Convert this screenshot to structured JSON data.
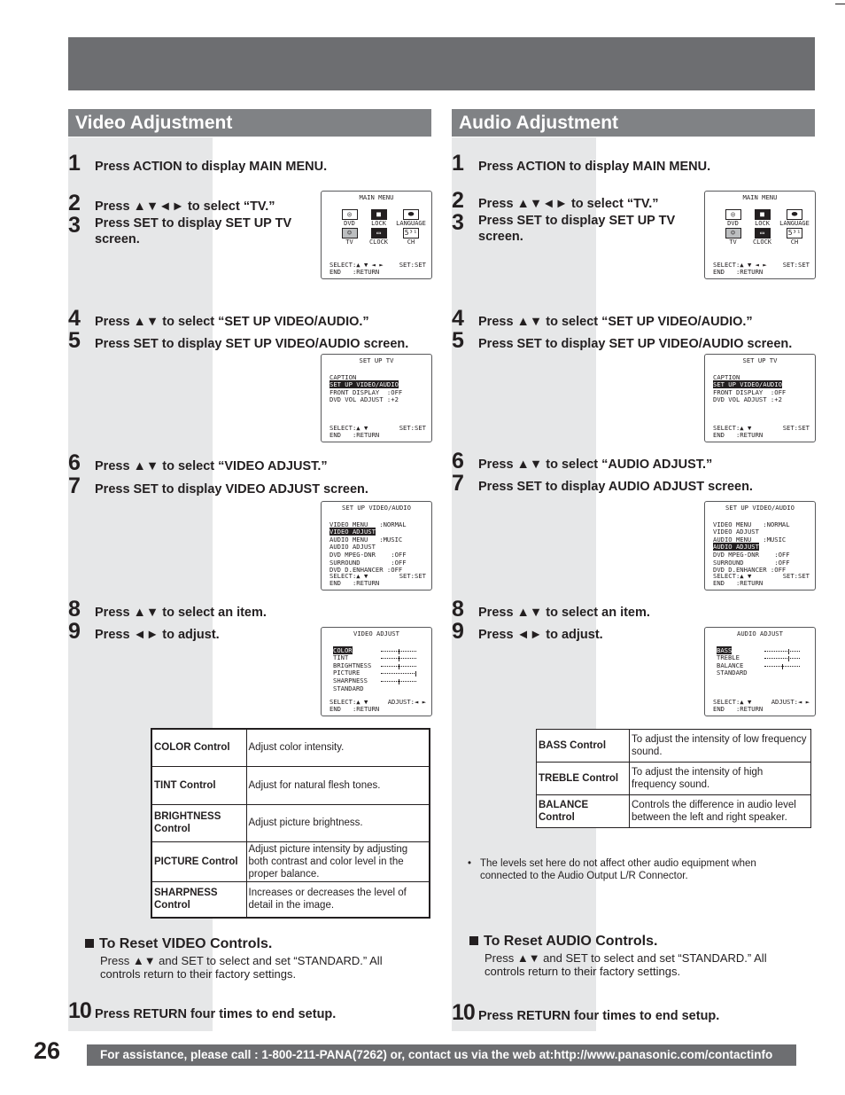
{
  "page": {
    "number": "26"
  },
  "footer": {
    "assistance": "For assistance, please call : 1-800-211-PANA(7262) or, contact us via the web at:http://www.panasonic.com/contactinfo"
  },
  "colors": {
    "banner": "#6d6e71",
    "section_title": "#808285",
    "shade": "#e6e7e8",
    "text": "#231f20"
  },
  "osd_common": {
    "main_menu": {
      "title": "MAIN MENU",
      "icons": [
        {
          "label": "DVD",
          "icon": "disc-icon"
        },
        {
          "label": "LOCK",
          "icon": "lock-icon"
        },
        {
          "label": "LANGUAGE",
          "icon": "lips-icon"
        },
        {
          "label": "TV",
          "icon": "tv-icon"
        },
        {
          "label": "CLOCK",
          "icon": "clock-icon"
        },
        {
          "label": "CH",
          "icon": "channel-icon"
        }
      ],
      "footer_left": "SELECT:▲ ▼ ◄ ►",
      "footer_right": "SET:SET",
      "footer_end": "END   :RETURN"
    },
    "setup_tv": {
      "title": "SET UP TV",
      "rows": [
        "CAPTION",
        "SET UP VIDEO/AUDIO",
        "FRONT DISPLAY  :OFF",
        "DVD VOL ADJUST :+2"
      ],
      "highlight": 1,
      "footer_left": "SELECT:▲ ▼",
      "footer_right": "SET:SET",
      "footer_end": "END   :RETURN"
    }
  },
  "video": {
    "title": "Video Adjustment",
    "steps": [
      {
        "n": "1",
        "text": "Press ACTION to display MAIN MENU."
      },
      {
        "n": "2",
        "text": "Press ▲▼◄► to select “TV.”"
      },
      {
        "n": "3",
        "text": "Press SET to display SET UP TV screen."
      },
      {
        "n": "4",
        "text": "Press ▲▼ to select “SET UP VIDEO/AUDIO.”"
      },
      {
        "n": "5",
        "text": "Press SET to display SET UP VIDEO/AUDIO screen."
      },
      {
        "n": "6",
        "text": "Press ▲▼ to select “VIDEO ADJUST.”"
      },
      {
        "n": "7",
        "text": "Press SET to display VIDEO ADJUST screen."
      },
      {
        "n": "8",
        "text": "Press ▲▼ to select an item."
      },
      {
        "n": "9",
        "text": "Press ◄► to adjust."
      },
      {
        "n": "10",
        "text": "Press RETURN four times to end setup."
      }
    ],
    "setup_va": {
      "title": "SET UP VIDEO/AUDIO",
      "rows": [
        "VIDEO MENU   :NORMAL",
        "VIDEO ADJUST",
        "AUDIO MENU   :MUSIC",
        "AUDIO ADJUST",
        "DVD MPEG-DNR    :OFF",
        "SURROUND        :OFF",
        "DVD D.ENHANCER :OFF"
      ],
      "highlight": 1,
      "footer_left": "SELECT:▲ ▼",
      "footer_right": "SET:SET",
      "footer_end": "END   :RETURN"
    },
    "adjust_screen": {
      "title": "VIDEO ADJUST",
      "items": [
        {
          "label": "COLOR",
          "level": 0.5
        },
        {
          "label": "TINT",
          "level": 0.5
        },
        {
          "label": "BRIGHTNESS",
          "level": 0.5
        },
        {
          "label": "PICTURE",
          "level": 1.0
        },
        {
          "label": "SHARPNESS",
          "level": 0.5
        },
        {
          "label": "STANDARD",
          "level": null
        }
      ],
      "highlight": 0,
      "footer_left": "SELECT:▲ ▼",
      "footer_right": "ADJUST:◄ ►",
      "footer_end": "END   :RETURN"
    },
    "controls": [
      {
        "name": "COLOR Control",
        "desc": "Adjust color intensity."
      },
      {
        "name": "TINT Control",
        "desc": "Adjust for natural flesh tones."
      },
      {
        "name": "BRIGHTNESS Control",
        "desc": "Adjust picture brightness."
      },
      {
        "name": "PICTURE Control",
        "desc": "Adjust picture intensity by adjusting both contrast and color level in the proper balance."
      },
      {
        "name": "SHARPNESS Control",
        "desc": "Increases or decreases the level of detail in the image."
      }
    ],
    "reset": {
      "heading": "To Reset VIDEO Controls.",
      "body": "Press ▲▼ and SET to select and set “STANDARD.” All controls return to their factory settings."
    }
  },
  "audio": {
    "title": "Audio Adjustment",
    "steps": [
      {
        "n": "1",
        "text": "Press ACTION to display MAIN MENU."
      },
      {
        "n": "2",
        "text": "Press ▲▼◄► to select “TV.”"
      },
      {
        "n": "3",
        "text": "Press SET to display SET UP TV screen."
      },
      {
        "n": "4",
        "text": "Press ▲▼ to select “SET UP VIDEO/AUDIO.”"
      },
      {
        "n": "5",
        "text": "Press SET to display SET UP VIDEO/AUDIO screen."
      },
      {
        "n": "6",
        "text": "Press ▲▼ to select “AUDIO ADJUST.”"
      },
      {
        "n": "7",
        "text": "Press SET to display AUDIO ADJUST screen."
      },
      {
        "n": "8",
        "text": "Press ▲▼ to select an item."
      },
      {
        "n": "9",
        "text": "Press ◄► to adjust."
      },
      {
        "n": "10",
        "text": "Press RETURN four times to end setup."
      }
    ],
    "setup_va": {
      "title": "SET UP VIDEO/AUDIO",
      "rows": [
        "VIDEO MENU   :NORMAL",
        "VIDEO ADJUST",
        "AUDIO MENU   :MUSIC",
        "AUDIO ADJUST",
        "DVD MPEG-DNR    :OFF",
        "SURROUND        :OFF",
        "DVD D.ENHANCER :OFF"
      ],
      "highlight": 3,
      "footer_left": "SELECT:▲ ▼",
      "footer_right": "SET:SET",
      "footer_end": "END   :RETURN"
    },
    "adjust_screen": {
      "title": "AUDIO ADJUST",
      "items": [
        {
          "label": "BASS",
          "level": 0.7
        },
        {
          "label": "TREBLE",
          "level": 0.7
        },
        {
          "label": "BALANCE",
          "level": 0.5
        },
        {
          "label": "STANDARD",
          "level": null
        }
      ],
      "highlight": 0,
      "footer_left": "SELECT:▲ ▼",
      "footer_right": "ADJUST:◄ ►",
      "footer_end": "END   :RETURN"
    },
    "controls": [
      {
        "name": "BASS Control",
        "desc": "To adjust the intensity of low frequency sound."
      },
      {
        "name": "TREBLE Control",
        "desc": "To adjust the intensity of high frequency sound."
      },
      {
        "name": "BALANCE Control",
        "desc": "Controls the difference in audio level between the left and right speaker."
      }
    ],
    "note": "The levels set here do not affect other audio equipment when connected to the Audio Output L/R Connector.",
    "reset": {
      "heading": "To Reset AUDIO Controls.",
      "body": "Press ▲▼ and SET to select and set “STANDARD.” All controls return to their factory settings."
    }
  }
}
